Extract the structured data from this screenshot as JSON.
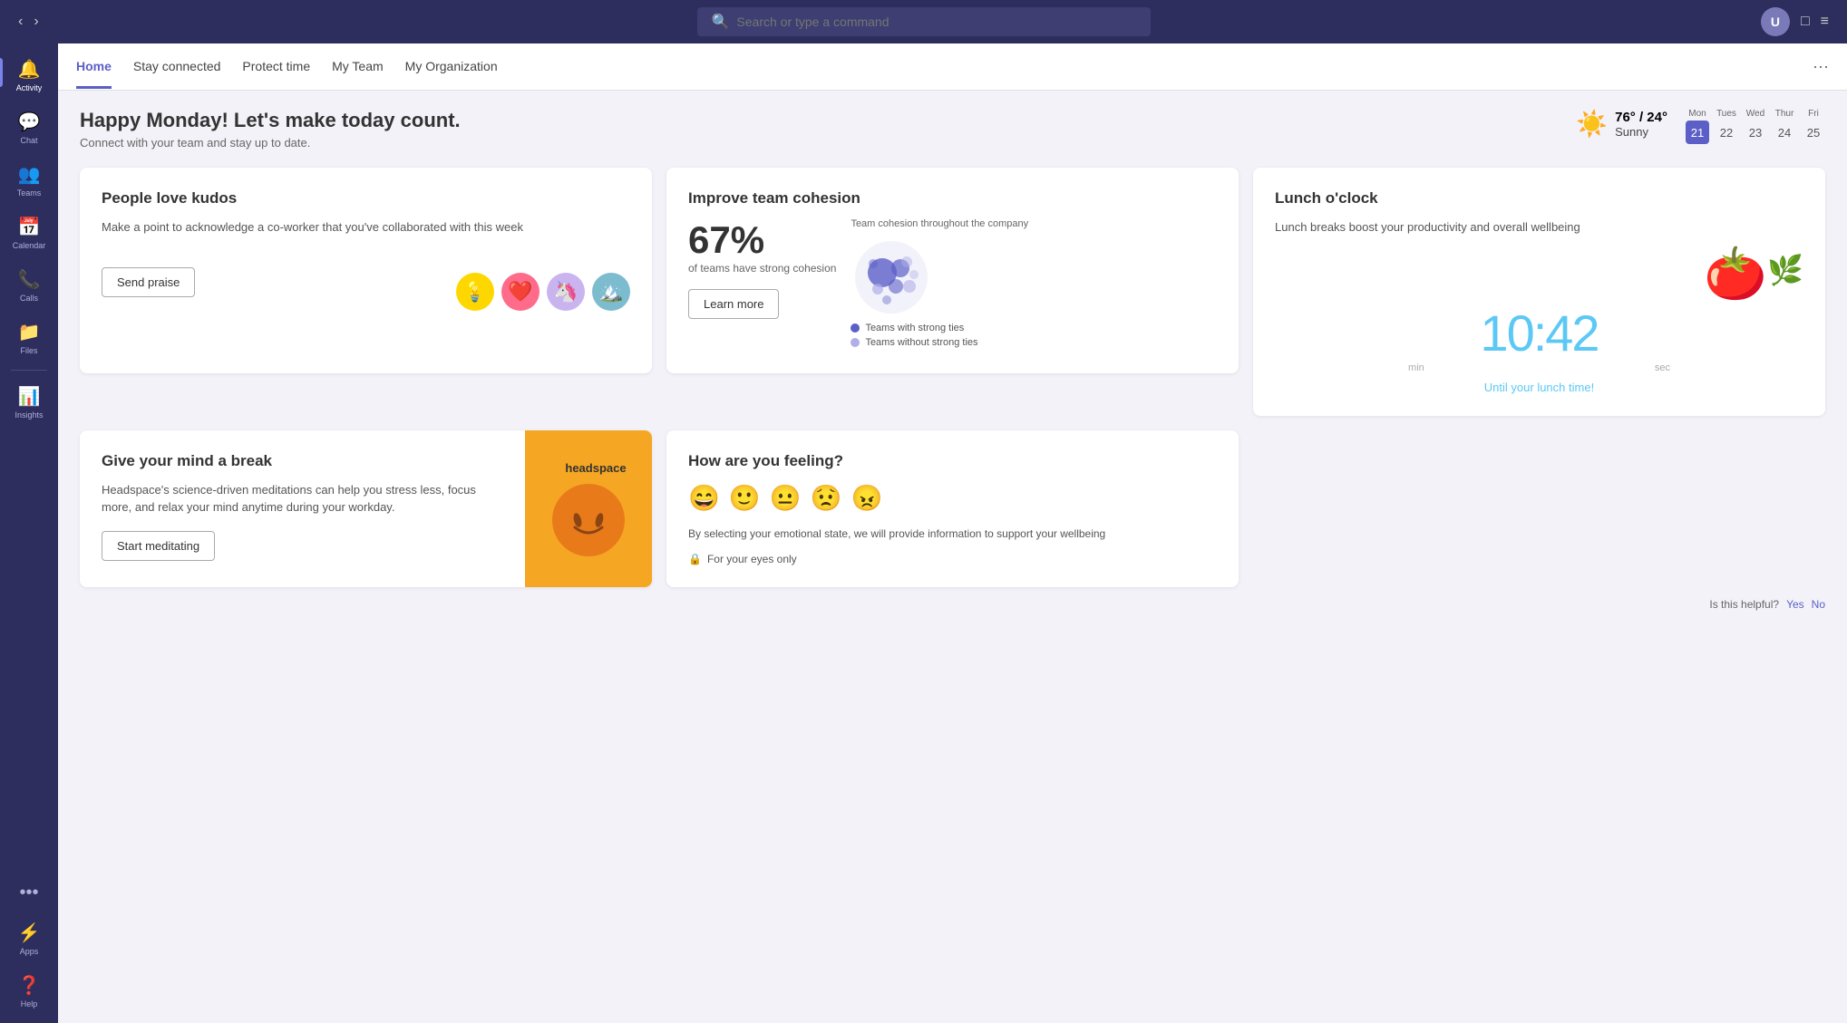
{
  "topbar": {
    "search_placeholder": "Search or type a command",
    "nav_back": "‹",
    "nav_forward": "›",
    "avatar_initials": "U",
    "icon_minimize": "□",
    "icon_more": "≡"
  },
  "sidebar": {
    "items": [
      {
        "id": "activity",
        "label": "Activity",
        "icon": "🔔"
      },
      {
        "id": "chat",
        "label": "Chat",
        "icon": "💬"
      },
      {
        "id": "teams",
        "label": "Teams",
        "icon": "👥"
      },
      {
        "id": "calendar",
        "label": "Calendar",
        "icon": "📅"
      },
      {
        "id": "calls",
        "label": "Calls",
        "icon": "📞"
      },
      {
        "id": "files",
        "label": "Files",
        "icon": "📁"
      },
      {
        "id": "insights",
        "label": "Insights",
        "icon": "📊"
      },
      {
        "id": "apps",
        "label": "Apps",
        "icon": "⚡"
      },
      {
        "id": "help",
        "label": "Help",
        "icon": "❓"
      }
    ]
  },
  "nav": {
    "tabs": [
      {
        "id": "home",
        "label": "Home",
        "active": true
      },
      {
        "id": "stay-connected",
        "label": "Stay connected",
        "active": false
      },
      {
        "id": "protect-time",
        "label": "Protect time",
        "active": false
      },
      {
        "id": "my-team",
        "label": "My Team",
        "active": false
      },
      {
        "id": "my-org",
        "label": "My Organization",
        "active": false
      }
    ],
    "more": "···"
  },
  "header": {
    "greeting": "Happy Monday! Let's make today count.",
    "subtitle": "Connect with your team and stay up to date."
  },
  "weather": {
    "icon": "☀️",
    "temp": "76° / 24°",
    "condition": "Sunny"
  },
  "calendar": {
    "days": [
      {
        "label": "Mon",
        "num": "21",
        "today": true
      },
      {
        "label": "Tues",
        "num": "22",
        "today": false
      },
      {
        "label": "Wed",
        "num": "23",
        "today": false
      },
      {
        "label": "Thur",
        "num": "24",
        "today": false
      },
      {
        "label": "Fri",
        "num": "25",
        "today": false
      }
    ]
  },
  "kudos_card": {
    "title": "People love kudos",
    "desc": "Make a point to acknowledge a co-worker that you've collaborated with this week",
    "button": "Send praise",
    "emojis": [
      "💡",
      "❤️",
      "🦄",
      "🏔️"
    ]
  },
  "cohesion_card": {
    "title": "Improve team cohesion",
    "chart_label": "Team cohesion throughout the company",
    "percentage": "67%",
    "sub_label": "of teams have strong cohesion",
    "legend": [
      {
        "label": "Teams with strong ties",
        "color": "#5b5fc7"
      },
      {
        "label": "Teams without strong ties",
        "color": "#b0aee8"
      }
    ],
    "button": "Learn more"
  },
  "lunch_card": {
    "title": "Lunch o'clock",
    "desc": "Lunch breaks boost your productivity and overall wellbeing",
    "timer_min": "10",
    "timer_sep": ":",
    "timer_sec": "42",
    "timer_min_label": "min",
    "timer_sec_label": "sec",
    "countdown": "Until your lunch time!"
  },
  "meditation_card": {
    "title": "Give your mind a break",
    "desc": "Headspace's science-driven meditations can help you stress less, focus more, and relax your mind anytime during your workday.",
    "button": "Start meditating",
    "brand": "headspace",
    "dot_color": "#f5a623"
  },
  "feeling_card": {
    "title": "How are you feeling?",
    "emojis": [
      "😄",
      "🙂",
      "😐",
      "😟",
      "😠"
    ],
    "desc": "By selecting your emotional state, we will provide information to support your wellbeing",
    "private": "For your eyes only"
  },
  "helpful": {
    "label": "Is this helpful?",
    "yes": "Yes",
    "no": "No"
  }
}
